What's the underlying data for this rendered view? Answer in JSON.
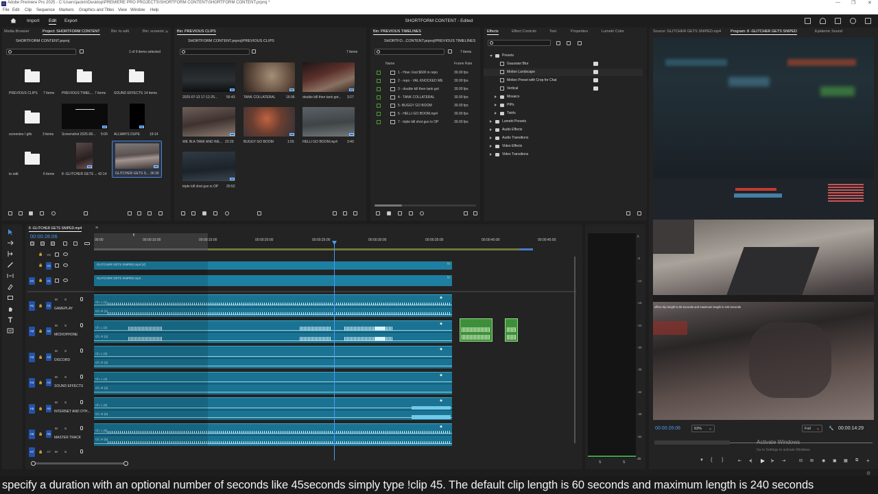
{
  "window": {
    "title": "Adobe Premiere Pro 2025 - C:\\Users\\jackm\\Desktop\\PREMIERE PRO PROJECTS\\SHORTFORM CONTENT\\SHORTFORM CONTENT.prproj *",
    "logo_text": "Pr",
    "controls": [
      "—",
      "❐",
      "✕"
    ]
  },
  "menu": [
    "File",
    "Edit",
    "Clip",
    "Sequence",
    "Markers",
    "Graphics and Titles",
    "View",
    "Window",
    "Help"
  ],
  "header": {
    "workspaces": [
      "Import",
      "Edit",
      "Export"
    ],
    "active_workspace": "Edit",
    "project_title": "SHORTFORM CONTENT - Edited"
  },
  "project_panel": {
    "tabs": [
      "Media Browser",
      "Project: SHORTFORM CONTENT",
      "Bin: to edit",
      "Bin: screenic"
    ],
    "file": "SHORTFORM CONTENT.prproj",
    "selection": "1 of 9 items selected",
    "items": [
      {
        "name": "PREVIOUS CLIPS",
        "meta": "7 items",
        "kind": "folder"
      },
      {
        "name": "PREVIOUS TIMEL...",
        "meta": "7 items",
        "kind": "folder"
      },
      {
        "name": "SOUND EFFECTS",
        "meta": "14 items",
        "kind": "folder"
      },
      {
        "name": "screenies / gifs",
        "meta": "3 items",
        "kind": "folder"
      },
      {
        "name": "Screenshot 2025-08...",
        "meta": "5:00",
        "kind": "dark"
      },
      {
        "name": "ALLWAYS DUPE",
        "meta": "19:14",
        "kind": "black"
      },
      {
        "name": "to edit",
        "meta": "6 items",
        "kind": "folder"
      },
      {
        "name": "8 -GLITCHER GETS ...",
        "meta": "42:14",
        "kind": "seq"
      },
      {
        "name": "GLITCHER GETS S...",
        "meta": "36:39",
        "kind": "game",
        "selected": true
      }
    ]
  },
  "clips_panel": {
    "tab": "Bin: PREVIOUS CLIPS",
    "path": "SHORTFORM CONTENT.prproj\\PREVIOUS CLIPS",
    "count": "7 items",
    "items": [
      {
        "name": "2025-07-13 17-12-25...",
        "meta": "56:43"
      },
      {
        "name": "TANK COLLATERAL",
        "meta": "16:06"
      },
      {
        "name": "double kill then tank got...",
        "meta": "3:27"
      },
      {
        "name": "WE IN A TANK AND WE...",
        "meta": "22:29"
      },
      {
        "name": "BUGGY GO BOOM",
        "meta": "1:55"
      },
      {
        "name": "HELLI GO BOOM.mp4",
        "meta": "3:40"
      },
      {
        "name": "triple kill shot gun is OP",
        "meta": "20:52"
      }
    ]
  },
  "timelines_panel": {
    "tab": "Bin: PREVIOUS TIMELINES",
    "path": "SHORTFO...CONTENT.prproj\\PREVIOUS TIMELINES",
    "count": "7 items",
    "columns": [
      "Name",
      "Frame Rate"
    ],
    "rows": [
      {
        "name": "1 - How i lost $600 in repo",
        "rate": "30.00 fps"
      },
      {
        "name": "2 - repo - VAL KNOCKED ME",
        "rate": "30.00 fps"
      },
      {
        "name": "3 - double kill then tank got",
        "rate": "30.00 fps"
      },
      {
        "name": "4 - TANK COLLATERAL",
        "rate": "30.00 fps"
      },
      {
        "name": "5- BUGGY GO BOOM",
        "rate": "30.00 fps"
      },
      {
        "name": "6 - HELLI GO BOOM.mp4",
        "rate": "30.00 fps"
      },
      {
        "name": "7 - triple kill shot gun is OP",
        "rate": "30.00 fps"
      }
    ]
  },
  "effects_panel": {
    "tabs": [
      "Effects",
      "Effect Controls",
      "Text",
      "Properties",
      "Lumetri Color"
    ],
    "tree": [
      {
        "label": "Presets",
        "level": 0,
        "open": true
      },
      {
        "label": "Gaussian Blur",
        "level": 1,
        "preset": true
      },
      {
        "label": "Motion Landscape",
        "level": 1,
        "preset": true,
        "selected": true
      },
      {
        "label": "Motion Preset with Crop for Chat",
        "level": 1,
        "preset": true
      },
      {
        "label": "Vertical",
        "level": 1,
        "preset": true
      },
      {
        "label": "Mosaics",
        "level": 1
      },
      {
        "label": "PIPs",
        "level": 1
      },
      {
        "label": "Twirls",
        "level": 1
      },
      {
        "label": "Lumetri Presets",
        "level": 0
      },
      {
        "label": "Audio Effects",
        "level": 0
      },
      {
        "label": "Audio Transitions",
        "level": 0
      },
      {
        "label": "Video Effects",
        "level": 0
      },
      {
        "label": "Video Transitions",
        "level": 0
      }
    ]
  },
  "monitor": {
    "tabs": [
      "Source: GLITCHER GETS SNIPED.mp4",
      "Program: 8 -GLITCHER GETS SNIPED",
      "Epidemic Sound"
    ],
    "timecode": "00:00:26:06",
    "zoom": "63%",
    "quality": "Full",
    "duration": "00:00:14:29",
    "overlay_hud": "effect clip length is 60 seconds and maximum length is 240 seconds",
    "activate_title": "Activate Windows",
    "activate_sub": "Go to Settings to activate Windows."
  },
  "timeline": {
    "sequence": "8 -GLITCHER GETS SNIPED.mp4",
    "timecode": "00:00:26:06",
    "ruler": [
      "00:00",
      "00:00:10:00",
      "00:00:15:00",
      "00:00:20:00",
      "00:00:25:00",
      "00:00:30:00",
      "00:00:35:00",
      "00:00:40:00",
      "00:00:45:00"
    ],
    "video_tracks": [
      {
        "id": "V3",
        "clip": ""
      },
      {
        "id": "V2",
        "clip": "GLITCHER GETS SNIPED.mp4 [V]"
      },
      {
        "id": "V1",
        "clip": "GLITCHER GETS SNIPED.mp4"
      }
    ],
    "audio_tracks": [
      {
        "id": "A1",
        "name": "GAMEPLAY",
        "ch": [
          "Ch. L (1)",
          "Ch. R (1)"
        ]
      },
      {
        "id": "A2",
        "name": "MICROPHONE",
        "ch": [
          "Ch. L (2)",
          "Ch. R (2)"
        ]
      },
      {
        "id": "A3",
        "name": "DISCORD",
        "ch": [
          "Ch. L (3)",
          "Ch. R (3)"
        ]
      },
      {
        "id": "A4",
        "name": "SOUND EFFECTS",
        "ch": [
          "Ch. L (4)",
          "Ch. R (4)"
        ]
      },
      {
        "id": "A5",
        "name": "INTERNET AND OTH...",
        "ch": [
          "Ch. L (5)",
          "Ch. R (5)"
        ]
      },
      {
        "id": "A6",
        "name": "MASTER TRACK",
        "ch": [
          "Ch. L (6)",
          "Ch. R (6)"
        ]
      },
      {
        "id": "A7",
        "name": "",
        "ch": []
      }
    ],
    "track_buttons": [
      "M",
      "S"
    ]
  },
  "meter": {
    "scale": [
      "0",
      "-6",
      "-12",
      "-18",
      "-24",
      "-30",
      "-36",
      "-42",
      "-48",
      "-54",
      "dB"
    ],
    "channels": [
      "S",
      "S"
    ]
  },
  "caption": "specify a duration with an optional number of seconds like 45seconds simply type !clip 45. The default clip length is 60 seconds and maximum length is 240 seconds"
}
